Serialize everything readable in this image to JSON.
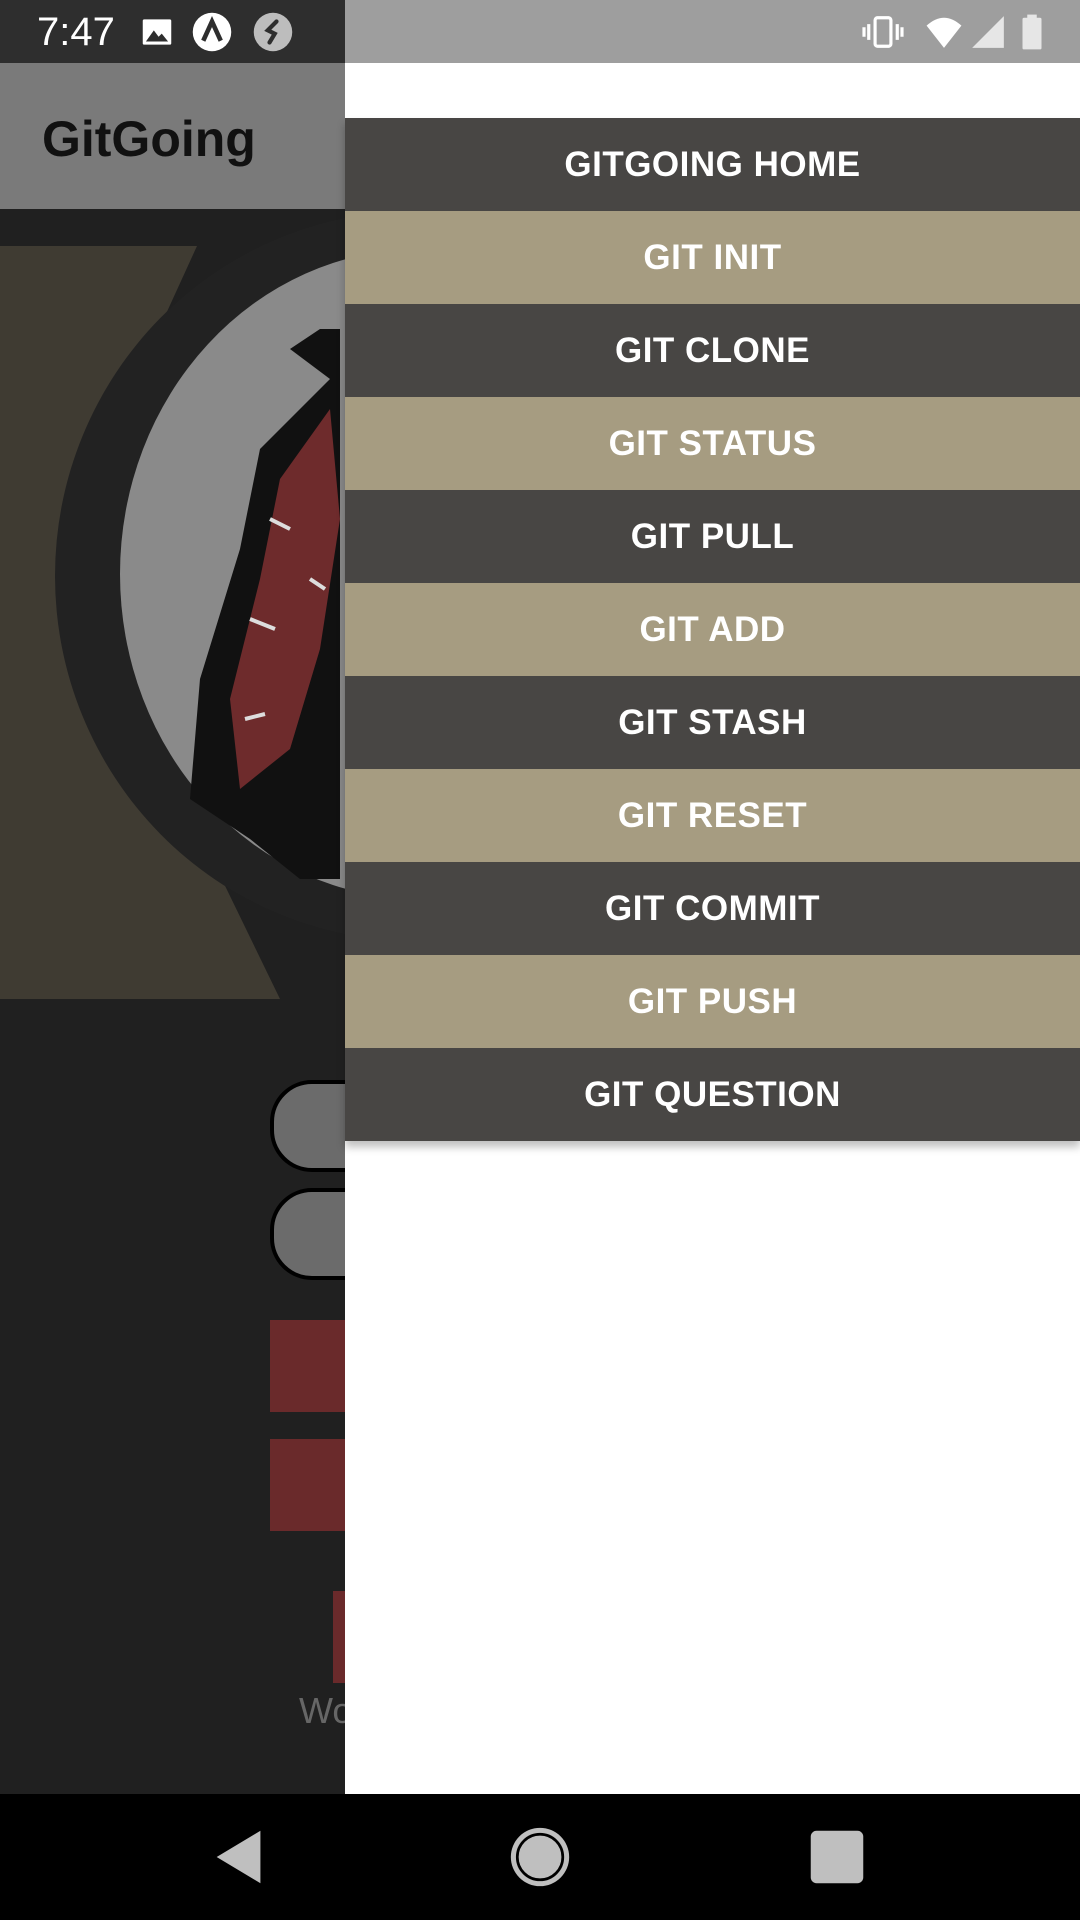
{
  "status_bar": {
    "time": "7:47",
    "left_icons": [
      "image-icon",
      "app-a-icon",
      "shazam-icon"
    ],
    "right_icons": [
      "vibrate-icon",
      "wifi-icon",
      "signal-icon",
      "battery-icon"
    ]
  },
  "app": {
    "title": "GitGoing",
    "partial_text": "Wo"
  },
  "drawer": {
    "items": [
      {
        "label": "GITGOING HOME",
        "style": "dark"
      },
      {
        "label": "GIT INIT",
        "style": "tan"
      },
      {
        "label": "GIT CLONE",
        "style": "dark"
      },
      {
        "label": "GIT STATUS",
        "style": "tan"
      },
      {
        "label": "GIT PULL",
        "style": "dark"
      },
      {
        "label": "GIT ADD",
        "style": "tan"
      },
      {
        "label": "GIT STASH",
        "style": "dark"
      },
      {
        "label": "GIT RESET",
        "style": "tan"
      },
      {
        "label": "GIT COMMIT",
        "style": "dark"
      },
      {
        "label": "GIT PUSH",
        "style": "tan"
      },
      {
        "label": "GIT QUESTION",
        "style": "dark"
      }
    ]
  },
  "colors": {
    "menu_dark": "#484644",
    "menu_tan": "#a69c81",
    "accent_red": "#6a2a2b"
  },
  "nav_bar": {
    "icons": [
      "back-icon",
      "home-icon",
      "recents-icon"
    ]
  }
}
